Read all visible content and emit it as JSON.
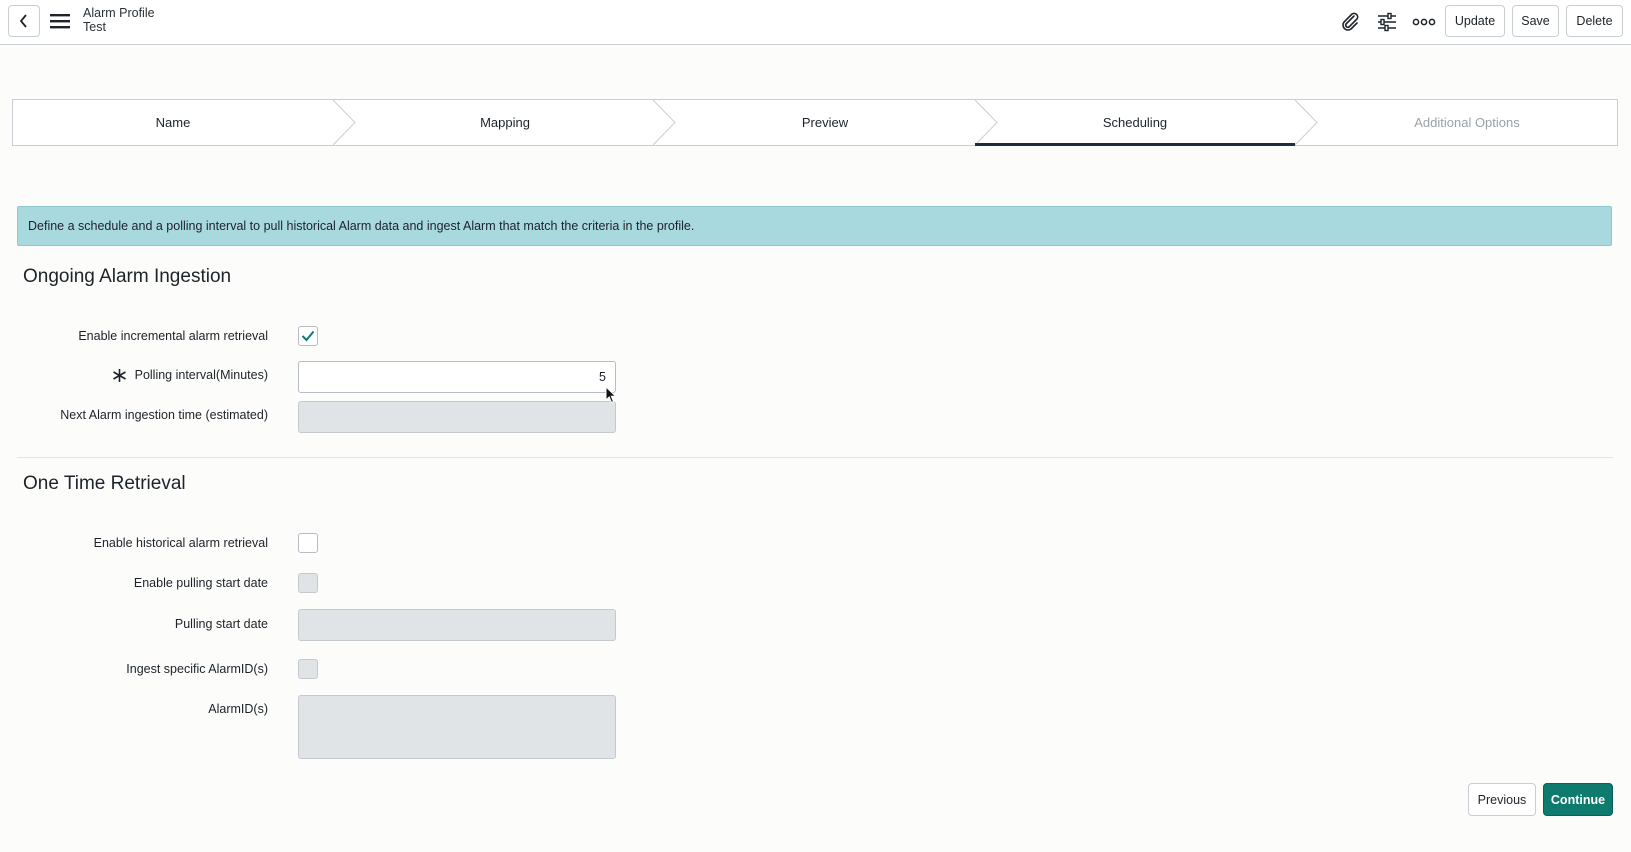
{
  "header": {
    "record_type": "Alarm Profile",
    "record_name": "Test",
    "buttons": {
      "update": "Update",
      "save": "Save",
      "delete": "Delete"
    }
  },
  "stepper": {
    "steps": [
      {
        "label": "Name",
        "state": "done"
      },
      {
        "label": "Mapping",
        "state": "done"
      },
      {
        "label": "Preview",
        "state": "done"
      },
      {
        "label": "Scheduling",
        "state": "active"
      },
      {
        "label": "Additional Options",
        "state": "disabled"
      }
    ]
  },
  "banner": {
    "text": "Define a schedule and a polling interval to pull historical Alarm data and ingest Alarm that match the criteria in the profile."
  },
  "ongoing": {
    "title": "Ongoing Alarm Ingestion",
    "enable_incremental_label": "Enable incremental alarm retrieval",
    "enable_incremental_checked": true,
    "polling_interval_label": "Polling interval(Minutes)",
    "polling_interval_value": "5",
    "next_ingestion_label": "Next Alarm ingestion time (estimated)",
    "next_ingestion_value": ""
  },
  "one_time": {
    "title": "One Time Retrieval",
    "enable_historical_label": "Enable historical alarm retrieval",
    "enable_historical_checked": false,
    "enable_start_date_label": "Enable pulling start date",
    "pulling_start_date_label": "Pulling start date",
    "pulling_start_date_value": "",
    "ingest_specific_label": "Ingest specific AlarmID(s)",
    "alarm_ids_label": "AlarmID(s)",
    "alarm_ids_value": ""
  },
  "footer": {
    "previous": "Previous",
    "continue": "Continue"
  },
  "colors": {
    "banner": "#a8d9de",
    "primary": "#0f7a6e",
    "active_step_underline": "#1e2d3b",
    "checkmark": "#0f7a6e"
  },
  "icons": [
    "back-icon",
    "hamburger-menu-icon",
    "paperclip-icon",
    "sliders-icon",
    "more-options-icon",
    "checkmark-icon",
    "required-asterisk-icon",
    "mouse-cursor-icon"
  ]
}
